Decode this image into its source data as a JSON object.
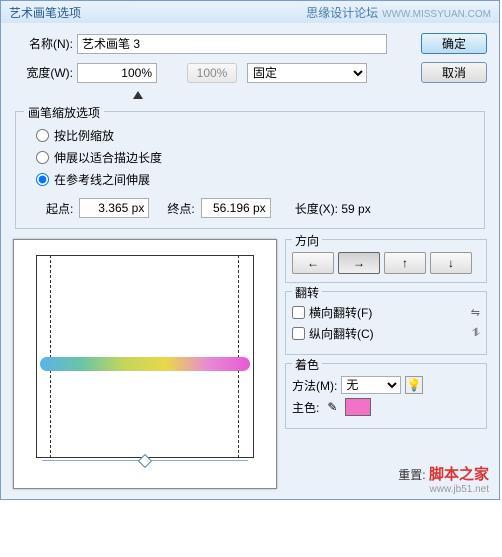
{
  "title": "艺术画笔选项",
  "forum": {
    "text": "思缘设计论坛",
    "url": "WWW.MISSYUAN.COM"
  },
  "buttons": {
    "ok": "确定",
    "cancel": "取消"
  },
  "name": {
    "label": "名称(N):",
    "value": "艺术画笔 3"
  },
  "width": {
    "label": "宽度(W):",
    "value": "100%",
    "button": "100%",
    "fixed_label": "固定"
  },
  "scale_group": {
    "title": "画笔缩放选项",
    "opt1": "按比例缩放",
    "opt2": "伸展以适合描边长度",
    "opt3": "在参考线之间伸展",
    "start_label": "起点:",
    "start": "3.365 px",
    "end_label": "终点:",
    "end": "56.196 px",
    "length_label": "长度(X): 59 px"
  },
  "direction": {
    "title": "方向"
  },
  "flip": {
    "title": "翻转",
    "h": "横向翻转(F)",
    "v": "纵向翻转(C)"
  },
  "tint": {
    "title": "着色",
    "method_label": "方法(M):",
    "method": "无",
    "key_label": "主色:"
  },
  "footer": {
    "reset": "重置:",
    "watermark": "脚本之家",
    "url": "www.jb51.net"
  }
}
